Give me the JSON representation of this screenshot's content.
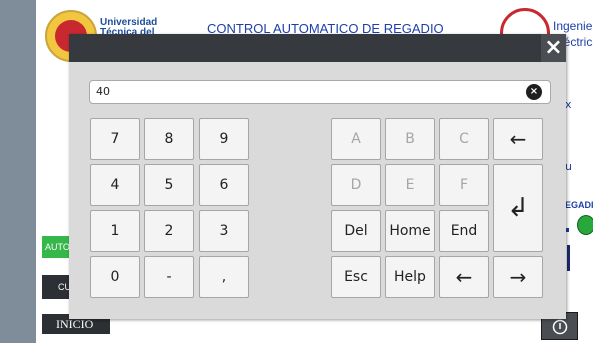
{
  "header": {
    "university_line1": "Universidad",
    "university_line2": "Técnica del",
    "title": "CONTROL AUTOMATICO DE REGADIO",
    "dept_line1": "Ingenieri",
    "dept_line2": "Eléctrica"
  },
  "side": {
    "label_x": "x",
    "label_u": "u",
    "label_regadi": "EGADI"
  },
  "buttons": {
    "auto": "AUTO",
    "cu": "CU",
    "inicio": "INICIO",
    "power_icon": "power-icon"
  },
  "keyboard": {
    "input_value": "40",
    "close_icon": "×",
    "clear_icon": "×",
    "keys": {
      "k7": "7",
      "k8": "8",
      "k9": "9",
      "k4": "4",
      "k5": "5",
      "k6": "6",
      "k1": "1",
      "k2": "2",
      "k3": "3",
      "k0": "0",
      "kminus": "-",
      "kcomma": ",",
      "kA": "A",
      "kB": "B",
      "kC": "C",
      "kbackspace": "←",
      "kD": "D",
      "kE": "E",
      "kF": "F",
      "kenter": "↲",
      "kdel": "Del",
      "khome": "Home",
      "kend": "End",
      "kesc": "Esc",
      "khelp": "Help",
      "kleft": "←",
      "kright": "→"
    }
  },
  "colors": {
    "accent_blue": "#1e3fa8",
    "auto_green": "#36b74a",
    "titlebar": "#36393d"
  }
}
